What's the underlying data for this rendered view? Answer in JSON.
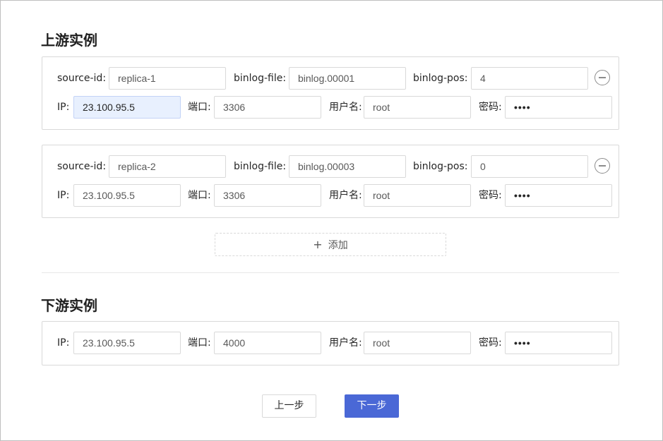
{
  "upstream": {
    "title": "上游实例",
    "instances": [
      {
        "source_id_label": "source-id",
        "source_id": "replica-1",
        "binlog_file_label": "binlog-file",
        "binlog_file": "binlog.00001",
        "binlog_pos_label": "binlog-pos",
        "binlog_pos": "4",
        "ip_label": "IP",
        "ip": "23.100.95.5",
        "port_label": "端口",
        "port": "3306",
        "user_label": "用户名",
        "user": "root",
        "password_label": "密码",
        "password": "••••"
      },
      {
        "source_id_label": "source-id",
        "source_id": "replica-2",
        "binlog_file_label": "binlog-file",
        "binlog_file": "binlog.00003",
        "binlog_pos_label": "binlog-pos",
        "binlog_pos": "0",
        "ip_label": "IP",
        "ip": "23.100.95.5",
        "port_label": "端口",
        "port": "3306",
        "user_label": "用户名",
        "user": "root",
        "password_label": "密码",
        "password": "••••"
      }
    ],
    "add_label": "添加",
    "add_icon": "+"
  },
  "downstream": {
    "title": "下游实例",
    "ip_label": "IP",
    "ip": "23.100.95.5",
    "port_label": "端口",
    "port": "4000",
    "user_label": "用户名",
    "user": "root",
    "password_label": "密码",
    "password": "••••"
  },
  "buttons": {
    "prev": "上一步",
    "next": "下一步"
  },
  "colors": {
    "primary": "#4a68d6",
    "autofill": "#e8f0fe",
    "border": "#d9d9d9"
  }
}
